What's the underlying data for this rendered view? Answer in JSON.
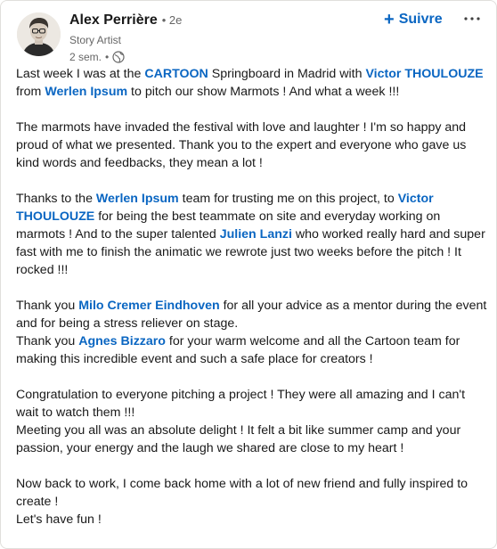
{
  "post": {
    "author": {
      "name": "Alex Perrière",
      "degree": "• 2e",
      "headline": "Story Artist",
      "time": "2 sem.",
      "dot": "•",
      "visibility_icon": "globe-icon"
    },
    "follow_label": "Suivre",
    "follow_icon": "plus-icon",
    "more_icon": "more-horizontal-icon",
    "colors": {
      "link": "#0a66c2",
      "text": "#191919",
      "muted": "#666666"
    },
    "paragraphs": [
      [
        {
          "t": "Last week I was at the "
        },
        {
          "t": "CARTOON",
          "k": "hl",
          "n": "cartoon-highlight"
        },
        {
          "t": " Springboard in Madrid with "
        },
        {
          "t": "Victor THOULOUZE",
          "k": "mention",
          "n": "mention-victor-thoulouze"
        },
        {
          "t": " from "
        },
        {
          "t": "Werlen Ipsum",
          "k": "mention",
          "n": "mention-werlen-ipsum"
        },
        {
          "t": " to pitch our show Marmots ! And what a week !!!"
        }
      ],
      [
        {
          "t": "The marmots have invaded the festival with love and laughter ! I'm so happy and proud of what we presented. Thank you to the expert and everyone who gave us kind words and feedbacks, they mean a lot !"
        }
      ],
      [
        {
          "t": "Thanks to the "
        },
        {
          "t": "Werlen Ipsum",
          "k": "mention",
          "n": "mention-werlen-ipsum"
        },
        {
          "t": " team for trusting me on this project, to "
        },
        {
          "t": "Victor THOULOUZE",
          "k": "mention",
          "n": "mention-victor-thoulouze"
        },
        {
          "t": " for being the best teammate on site and everyday working on marmots ! And to the super talented "
        },
        {
          "t": "Julien Lanzi",
          "k": "mention",
          "n": "mention-julien-lanzi"
        },
        {
          "t": " who worked really hard and super fast with me to finish the animatic we rewrote just two weeks before the pitch ! It rocked !!!"
        }
      ],
      [
        {
          "t": "Thank you "
        },
        {
          "t": "Milo Cremer Eindhoven",
          "k": "mention",
          "n": "mention-milo-cremer-eindhoven"
        },
        {
          "t": " for all your advice as a mentor during the event and for being a stress reliever on stage."
        },
        {
          "br": true
        },
        {
          "t": "Thank you "
        },
        {
          "t": "Agnes Bizzaro",
          "k": "mention",
          "n": "mention-agnes-bizzaro"
        },
        {
          "t": " for your warm welcome and all the Cartoon team for making this incredible event and such a safe place for creators !"
        }
      ],
      [
        {
          "t": "Congratulation to everyone pitching a project ! They were all amazing and I can't wait to watch them !!!"
        },
        {
          "br": true
        },
        {
          "t": "Meeting you all was an absolute delight ! It felt a bit like summer camp and your passion, your energy and the laugh we shared are close to my heart !"
        }
      ],
      [
        {
          "t": "Now back to work, I come back home with a lot of new friend and fully inspired to create !"
        },
        {
          "br": true
        },
        {
          "t": "Let's have fun !"
        }
      ]
    ]
  }
}
